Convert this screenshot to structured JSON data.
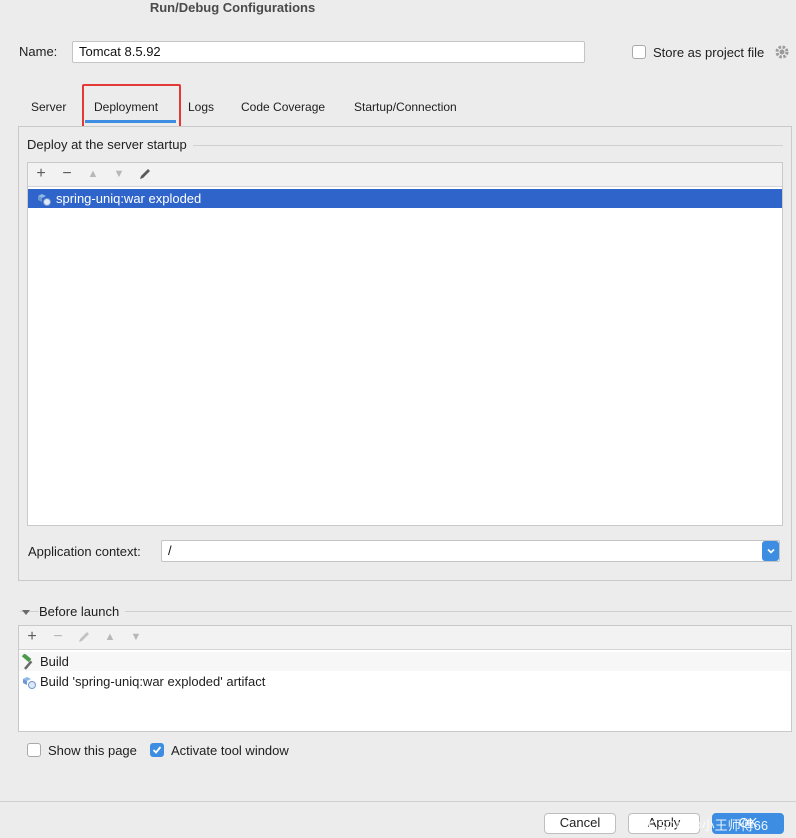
{
  "window": {
    "title": "Run/Debug Configurations"
  },
  "name_field": {
    "label": "Name:",
    "value": "Tomcat 8.5.92"
  },
  "store_as_project": {
    "label": "Store as project file",
    "checked": false
  },
  "tabs": [
    {
      "label": "Server"
    },
    {
      "label": "Deployment"
    },
    {
      "label": "Logs"
    },
    {
      "label": "Code Coverage"
    },
    {
      "label": "Startup/Connection"
    }
  ],
  "active_tab": "Deployment",
  "deploy_section": {
    "title": "Deploy at the server startup",
    "toolbar": [
      {
        "icon": "plus-icon",
        "symbol": "+",
        "enabled": true
      },
      {
        "icon": "minus-icon",
        "symbol": "−",
        "enabled": true
      },
      {
        "icon": "arrow-up-icon",
        "symbol": "▲",
        "enabled": false
      },
      {
        "icon": "arrow-down-icon",
        "symbol": "▼",
        "enabled": false
      },
      {
        "icon": "pencil-icon",
        "symbol": "✎",
        "enabled": true
      }
    ],
    "items": [
      {
        "label": "spring-uniq:war exploded",
        "icon": "artifact-icon",
        "selected": true
      }
    ]
  },
  "app_context": {
    "label": "Application context:",
    "value": "/"
  },
  "before_launch": {
    "title": "Before launch",
    "toolbar": [
      {
        "icon": "plus-icon",
        "symbol": "+",
        "enabled": true
      },
      {
        "icon": "minus-icon",
        "symbol": "−",
        "enabled": false
      },
      {
        "icon": "pencil-icon",
        "symbol": "✎",
        "enabled": false
      },
      {
        "icon": "arrow-up-icon",
        "symbol": "▲",
        "enabled": false
      },
      {
        "icon": "arrow-down-icon",
        "symbol": "▼",
        "enabled": false
      }
    ],
    "items": [
      {
        "label": "Build",
        "icon": "hammer-icon"
      },
      {
        "label": "Build 'spring-uniq:war exploded' artifact",
        "icon": "artifact-icon"
      }
    ]
  },
  "show_this_page": {
    "label": "Show this page",
    "checked": false
  },
  "activate_tool_window": {
    "label": "Activate tool window",
    "checked": true
  },
  "buttons": {
    "cancel": "Cancel",
    "apply": "Apply",
    "ok": "OK"
  },
  "watermark": "CSDN @小王师傅66",
  "colors": {
    "accent": "#3d8ee2",
    "selection": "#2f65ca",
    "highlight": "#e53935"
  }
}
